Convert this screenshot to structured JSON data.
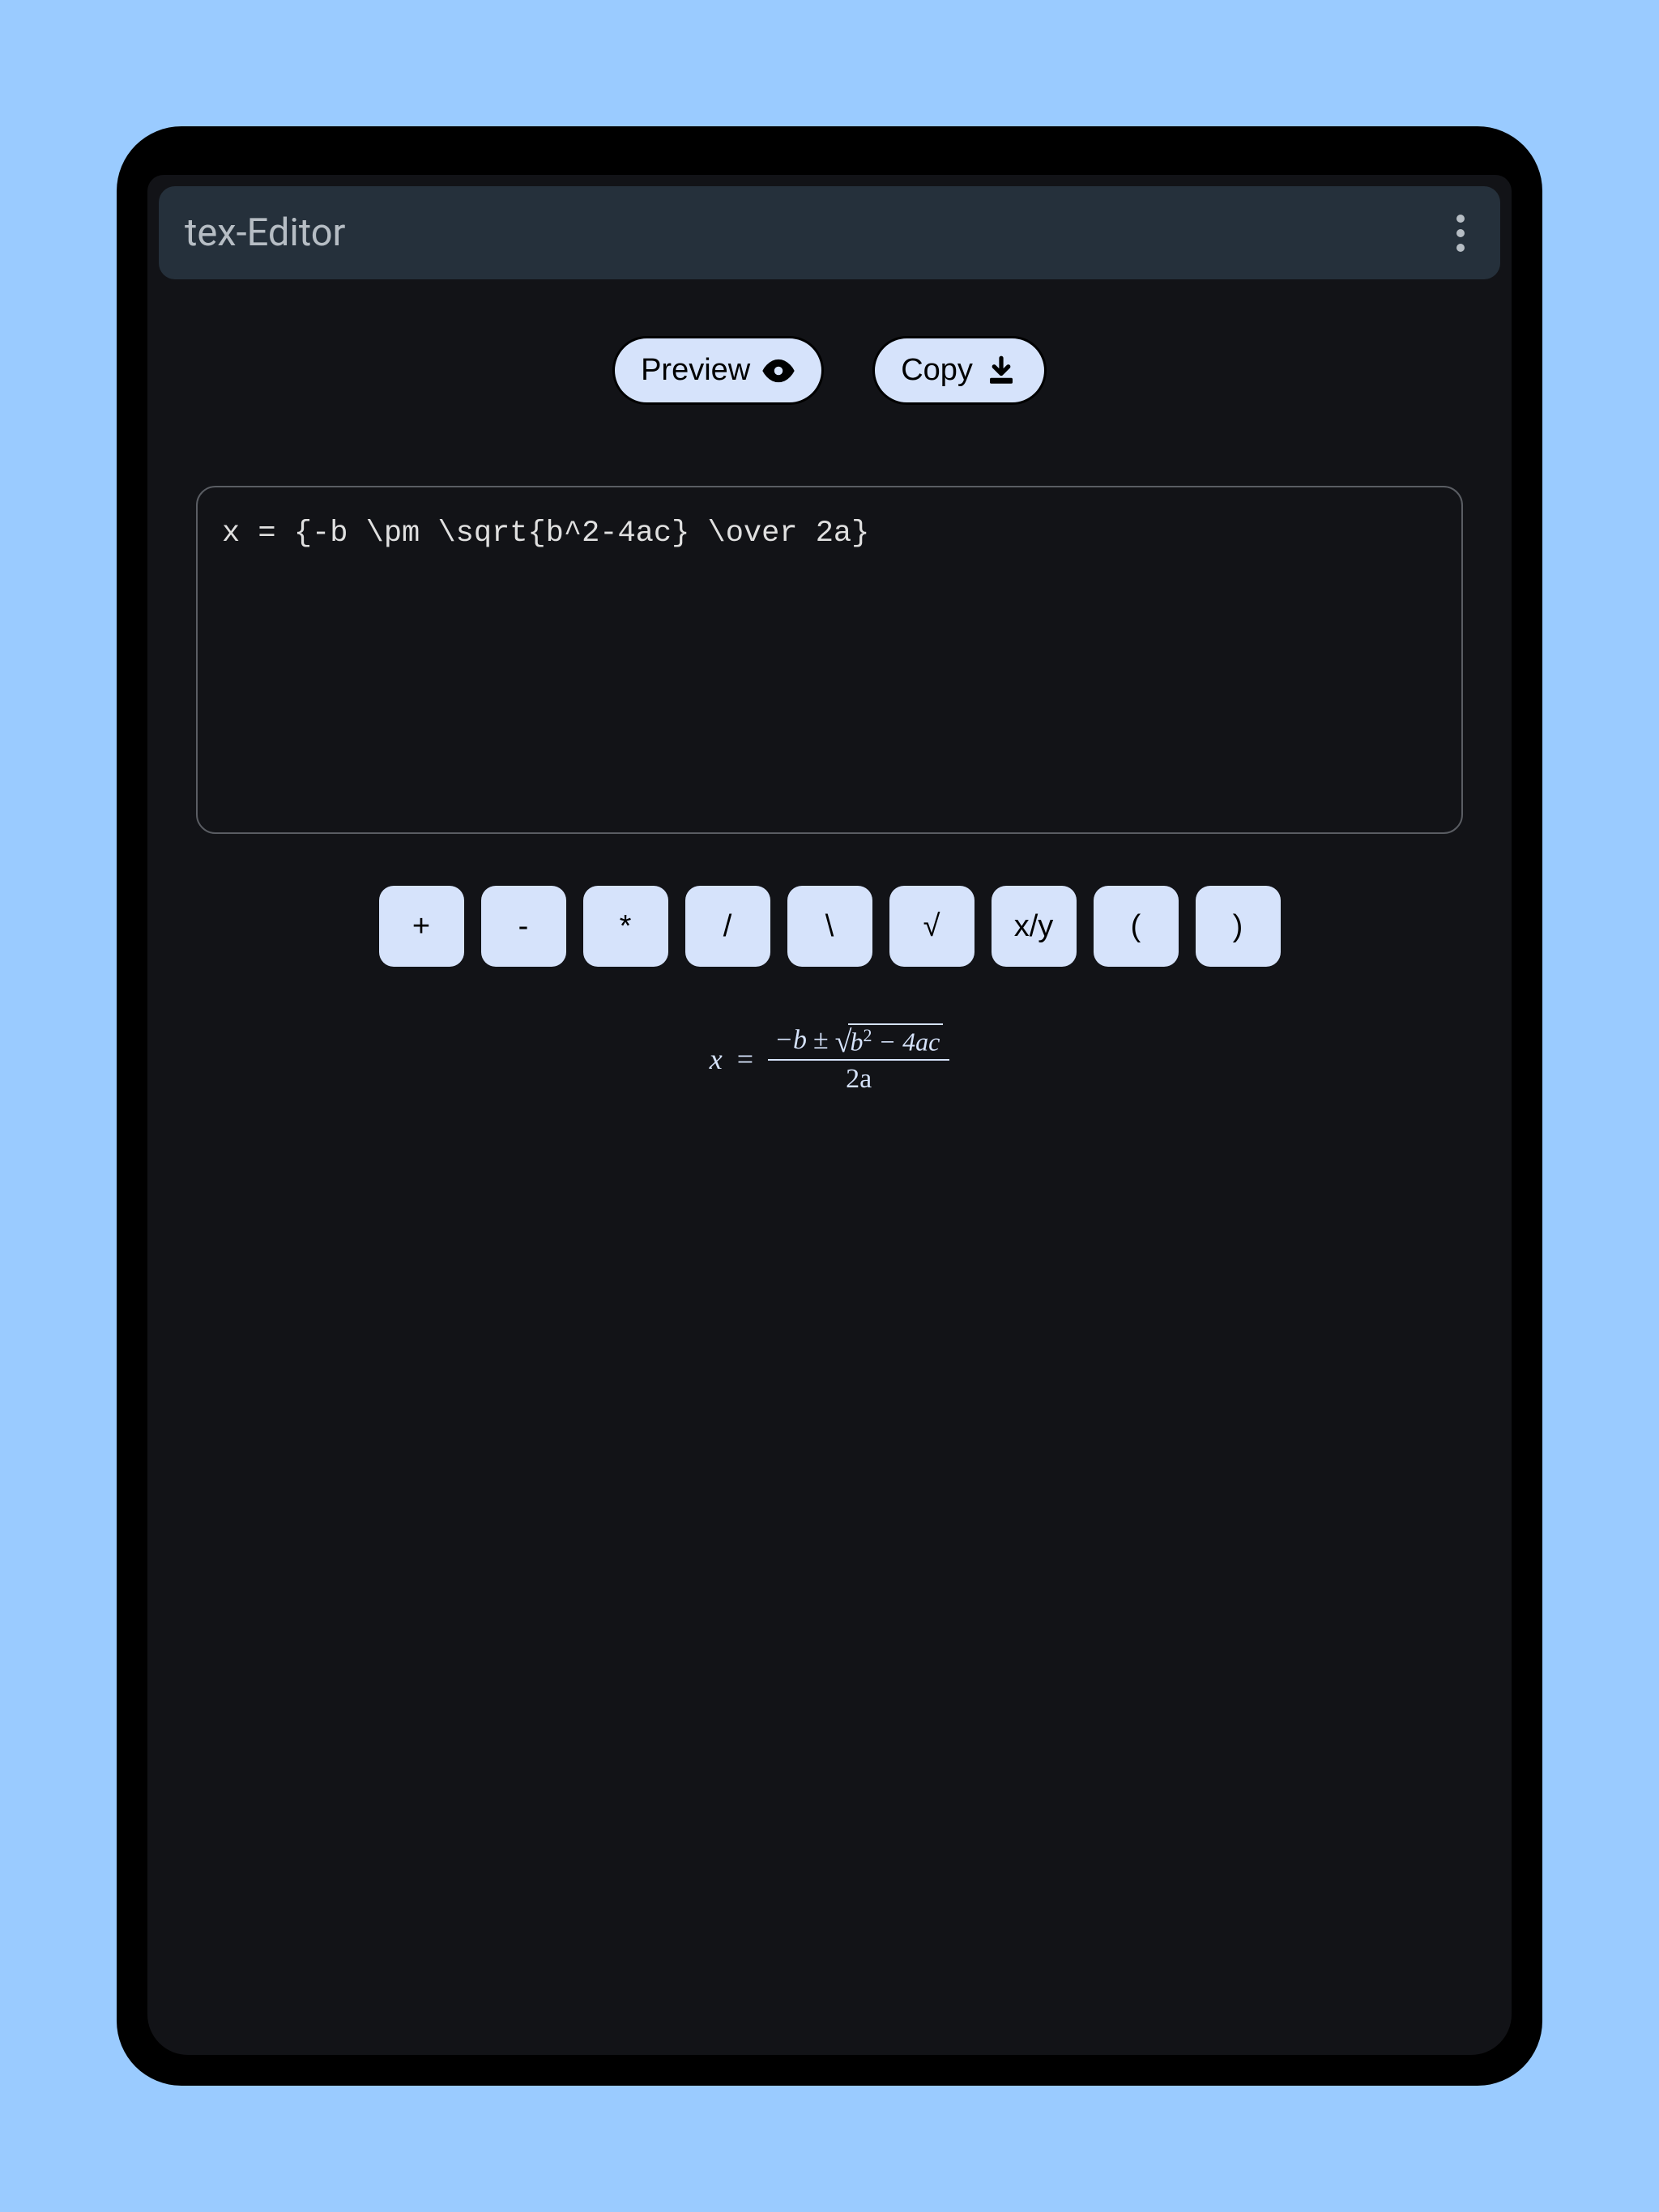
{
  "app": {
    "title": "tex-Editor"
  },
  "actions": {
    "preview_label": "Preview",
    "copy_label": "Copy"
  },
  "editor": {
    "tex_source": "x = {-b \\pm \\sqrt{b^2-4ac} \\over 2a}"
  },
  "symbols": [
    "+",
    "-",
    "*",
    "/",
    "\\",
    "√",
    "x/y",
    "(",
    ")"
  ],
  "preview": {
    "lhs_var": "x",
    "equals": "=",
    "numerator_lead": "−b",
    "pm": "±",
    "sqrt_symbol": "√",
    "radicand_lead": "b",
    "radicand_exp": "2",
    "radicand_tail": " − 4ac",
    "denominator": "2a"
  }
}
